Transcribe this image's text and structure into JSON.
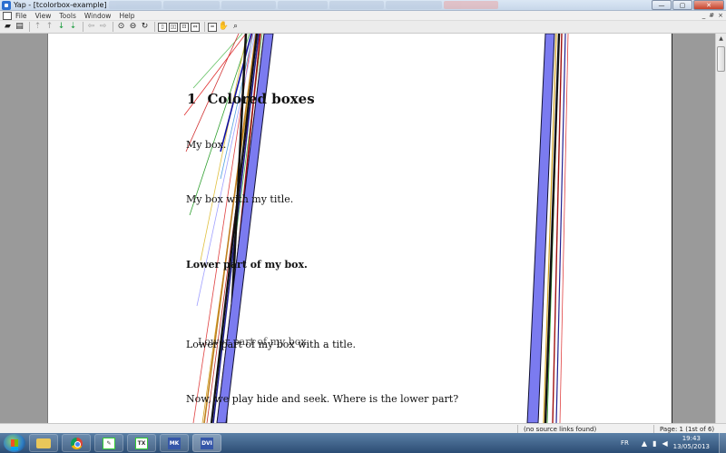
{
  "window": {
    "title": "Yap - [tcolorbox-example]",
    "controls": {
      "minimize": "—",
      "maximize": "▢",
      "close": "✕"
    }
  },
  "menu": {
    "items": [
      "File",
      "View",
      "Tools",
      "Window",
      "Help"
    ],
    "mdi_controls": [
      "_",
      "#",
      "×"
    ]
  },
  "toolbar": {
    "icons": [
      "open-icon",
      "print-icon",
      "go-up-icon",
      "go-up-disabled-icon",
      "go-down-icon",
      "go-to-end-icon",
      "back-icon",
      "forward-icon",
      "zoom-circle-icon",
      "zoom-minus-icon",
      "refresh-icon",
      "single-page-icon",
      "two-page-icon",
      "fit-page-icon",
      "fit-width-icon",
      "ruler-icon",
      "hand-icon",
      "magnifier-icon"
    ]
  },
  "document": {
    "heading_number": "1",
    "heading_text": "Colored boxes",
    "lines": [
      "My box.",
      "My box with my title.",
      "Lower part of my box.",
      "Lower part of my box with a title.",
      "Now, we play hide and seek. Where is the lower part?"
    ],
    "colors": {
      "blue_band": "#7b7bf0",
      "band_edge": "#111133"
    }
  },
  "status": {
    "source_links": "(no source links found)",
    "page_indicator": "Page: 1 (1st of 6)"
  },
  "taskbar": {
    "language": "FR",
    "time": "19:43",
    "date": "13/05/2013",
    "apps": [
      "explorer-icon",
      "chrome-icon",
      "editor-icon",
      "texmaker-icon",
      "miktex-icon",
      "yap-icon"
    ]
  }
}
